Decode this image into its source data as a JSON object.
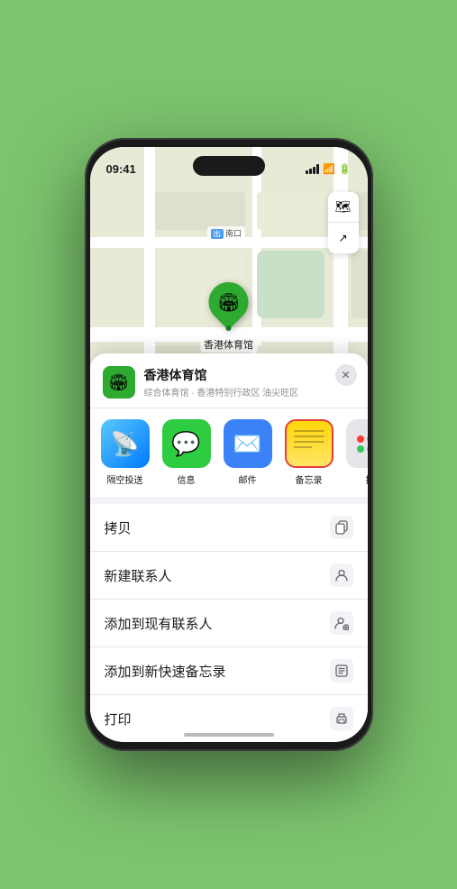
{
  "statusBar": {
    "time": "09:41",
    "locationArrow": "▶"
  },
  "mapControls": {
    "mapIcon": "🗺",
    "locationIcon": "⬆"
  },
  "mapLabel": {
    "entrance": "南口"
  },
  "venue": {
    "name": "香港体育馆",
    "description": "综合体育馆 · 香港特别行政区 油尖旺区",
    "icon": "🏟"
  },
  "shareItems": [
    {
      "id": "airdrop",
      "label": "隔空投送",
      "iconClass": "share-icon-airdrop",
      "symbol": "📡"
    },
    {
      "id": "messages",
      "label": "信息",
      "iconClass": "share-icon-messages",
      "symbol": "💬"
    },
    {
      "id": "mail",
      "label": "邮件",
      "iconClass": "share-icon-mail",
      "symbol": "✉"
    },
    {
      "id": "notes",
      "label": "备忘录",
      "iconClass": "share-icon-notes",
      "symbol": ""
    },
    {
      "id": "more",
      "label": "提",
      "iconClass": "share-icon-more",
      "symbol": "⋯"
    }
  ],
  "actionRows": [
    {
      "label": "拷贝",
      "icon": "📋"
    },
    {
      "label": "新建联系人",
      "icon": "👤"
    },
    {
      "label": "添加到现有联系人",
      "icon": "👤"
    },
    {
      "label": "添加到新快速备忘录",
      "icon": "🗒"
    },
    {
      "label": "打印",
      "icon": "🖨"
    }
  ],
  "closeButton": "✕"
}
